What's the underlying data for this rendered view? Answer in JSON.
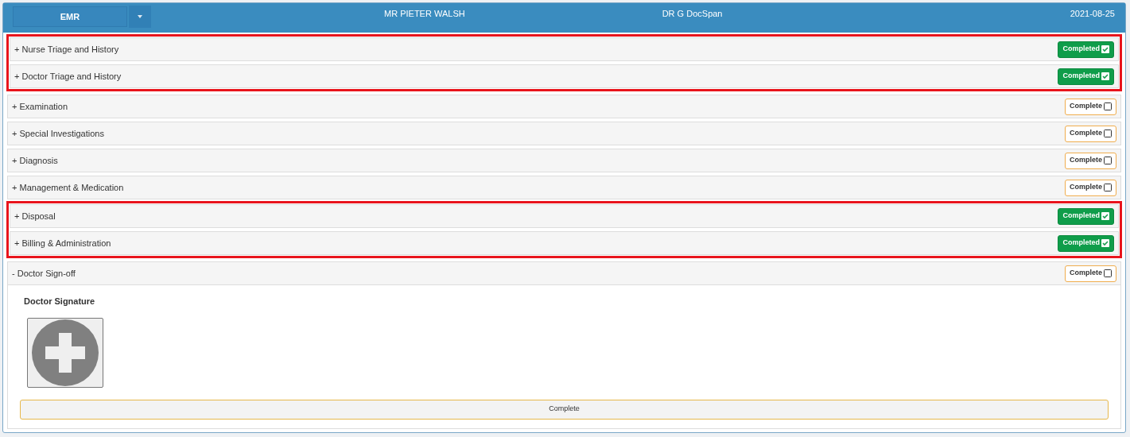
{
  "header": {
    "dropdown": "EMR",
    "patient": "MR PIETER WALSH",
    "doctor": "DR G DocSpan",
    "date": "2021-08-25"
  },
  "sections": [
    {
      "toggle": "+",
      "label": "Nurse Triage and History",
      "badge": "Completed",
      "completed": true,
      "highlighted": true
    },
    {
      "toggle": "+",
      "label": "Doctor Triage and History",
      "badge": "Completed",
      "completed": true,
      "highlighted": true
    },
    {
      "toggle": "+",
      "label": "Examination",
      "badge": "Complete",
      "completed": false,
      "highlighted": false
    },
    {
      "toggle": "+",
      "label": "Special Investigations",
      "badge": "Complete",
      "completed": false,
      "highlighted": false
    },
    {
      "toggle": "+",
      "label": "Diagnosis",
      "badge": "Complete",
      "completed": false,
      "highlighted": false
    },
    {
      "toggle": "+",
      "label": "Management & Medication",
      "badge": "Complete",
      "completed": false,
      "highlighted": false
    },
    {
      "toggle": "+",
      "label": "Disposal",
      "badge": "Completed",
      "completed": true,
      "highlighted": true
    },
    {
      "toggle": "+",
      "label": "Billing & Administration",
      "badge": "Completed",
      "completed": true,
      "highlighted": true
    },
    {
      "toggle": "-",
      "label": "Doctor Sign-off",
      "badge": "Complete",
      "completed": false,
      "highlighted": false,
      "content": {
        "signature_label": "Doctor Signature",
        "button": "Complete"
      }
    }
  ]
}
